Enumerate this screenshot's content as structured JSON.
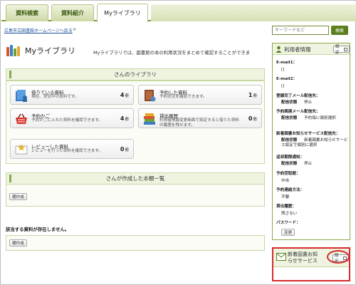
{
  "tabs": [
    {
      "label": "資料検索"
    },
    {
      "label": "資料紹介"
    },
    {
      "label": "Myライブラリ"
    }
  ],
  "breadcrumb": {
    "link": "広島市立図書館ホームページへ戻る",
    "sep": ">"
  },
  "search": {
    "placeholder": "キーワードなど",
    "button": "検索"
  },
  "main": {
    "title": "Myライブラリ",
    "description": "Myライブラリでは、図書館の本の利用状況をまとめて確認することができま",
    "library_heading": "さんのライブラリ",
    "cards": [
      {
        "title": "借りている資料",
        "sub": "現在、貸受中の資料です。",
        "count": "4",
        "unit": "冊",
        "icon": "borrowed-books-icon"
      },
      {
        "title": "予約した資料",
        "sub": "予約状況を確認できます。",
        "count": "1",
        "unit": "冊",
        "icon": "reserved-book-icon"
      },
      {
        "title": "予約かご",
        "sub": "予約かごに入れた資料を確認できます。",
        "count": "4",
        "unit": "冊",
        "icon": "basket-icon"
      },
      {
        "title": "貸出履歴",
        "sub": "利用者情報変更画面で設定すると借りた資料の履歴を残せます。",
        "count": "0",
        "unit": "冊",
        "icon": "history-books-icon"
      },
      {
        "title": "レビューした資料",
        "sub": "レビューを行った資料を確認できます。",
        "count": "0",
        "unit": "冊",
        "icon": "review-icon"
      }
    ],
    "shelf_heading": "さんが作成した本棚一覧",
    "shelf_button": "棚作成",
    "no_items": "該当する資料が存在しません。",
    "shelf_button2": "棚作成"
  },
  "sidebar": {
    "title": "利用者情報",
    "settings_label": "設定",
    "email1_label": "E-mail1：",
    "email1_value": "[]",
    "email2_label": "E-mail2：",
    "email2_value": "[]",
    "reg_notice_label": "登録完了メール配信先：",
    "reg_status_label": "配信状態",
    "reg_status_value": "停止",
    "resv_notice_label": "予約関連メール配信先：",
    "resv_status_label": "配信状態",
    "resv_status_value": "予約毎に個別選択",
    "new_notice_label": "新着図書お知らせサービス配信先：",
    "new_status_label": "配信状態",
    "new_status_value": "新着図書お知らせサービス設定で個別に選択",
    "return_notice_label": "返却期限通知：",
    "return_status_label": "配信状態",
    "return_status_value": "停止",
    "pickup_label": "予約受取館：",
    "pickup_value": "中央",
    "contact_label": "予約連絡方法：",
    "contact_value": "不要",
    "history_label": "貸出履歴：",
    "history_value": "残さない",
    "password_label": "パスワード：",
    "password_button": "変更"
  },
  "news": {
    "title": "新着図書お知らせサービス",
    "settings_label": "設定"
  }
}
